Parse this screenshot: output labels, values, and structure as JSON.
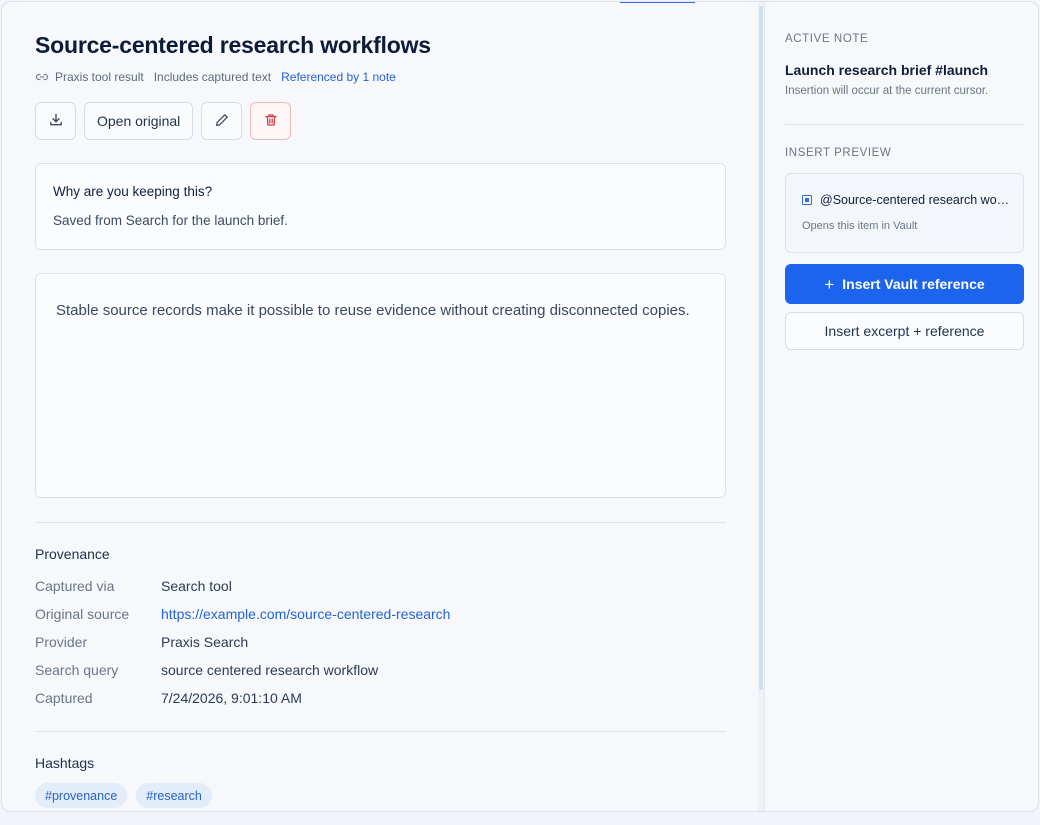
{
  "item": {
    "title": "Source-centered research workflows",
    "meta": {
      "link_icon": "link-icon",
      "type": "Praxis tool result",
      "captured": "Includes captured text",
      "referenced": "Referenced by 1 note"
    },
    "actions": {
      "download_icon": "download-icon",
      "open_original_label": "Open original",
      "edit_icon": "pencil-icon",
      "delete_icon": "trash-icon"
    },
    "why": {
      "question": "Why are you keeping this?",
      "answer": "Saved from Search for the launch brief."
    },
    "body": "Stable source records make it possible to reuse evidence without creating disconnected copies."
  },
  "provenance": {
    "heading": "Provenance",
    "rows": [
      {
        "label": "Captured via",
        "value": "Search tool"
      },
      {
        "label": "Original source",
        "value": "https://example.com/source-centered-research"
      },
      {
        "label": "Provider",
        "value": "Praxis Search"
      },
      {
        "label": "Search query",
        "value": "source centered research workflow"
      },
      {
        "label": "Captured",
        "value": "7/24/2026, 9:01:10 AM"
      }
    ]
  },
  "hashtags": {
    "heading": "Hashtags",
    "tags": [
      "#provenance",
      "#research"
    ]
  },
  "sidebar": {
    "active_note_label": "ACTIVE NOTE",
    "active_note_title": "Launch research brief #launch",
    "active_note_sub": "Insertion will occur at the current cursor.",
    "insert_preview_label": "INSERT PREVIEW",
    "preview_text": "@Source-centered research workflows",
    "preview_icon": "reference-icon",
    "preview_sub": "Opens this item in Vault",
    "insert_reference_label": "Insert Vault reference",
    "insert_excerpt_label": "Insert excerpt + reference"
  },
  "colors": {
    "accent": "#1c63ee",
    "link": "#2463d6",
    "danger": "#d63a47",
    "tag_bg": "#e3ecf9"
  }
}
